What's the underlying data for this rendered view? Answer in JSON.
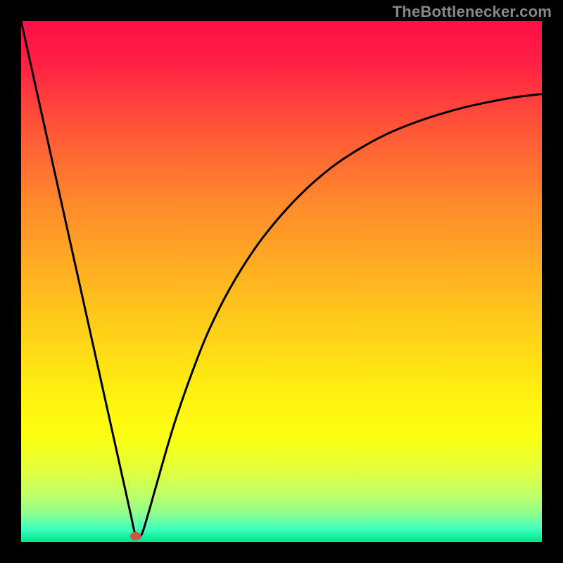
{
  "watermark": "TheBottlenecker.com",
  "chart_data": {
    "type": "line",
    "title": "",
    "xlabel": "",
    "ylabel": "",
    "xlim": [
      0,
      100
    ],
    "ylim": [
      0,
      100
    ],
    "grid": false,
    "background_gradient": {
      "stops": [
        {
          "offset": 0.0,
          "color": "#ff0e46"
        },
        {
          "offset": 0.08,
          "color": "#ff2044"
        },
        {
          "offset": 0.2,
          "color": "#ff5338"
        },
        {
          "offset": 0.35,
          "color": "#ff8a2c"
        },
        {
          "offset": 0.55,
          "color": "#ffc41c"
        },
        {
          "offset": 0.72,
          "color": "#fff210"
        },
        {
          "offset": 0.8,
          "color": "#fbff12"
        },
        {
          "offset": 0.86,
          "color": "#e3ff3a"
        },
        {
          "offset": 0.91,
          "color": "#bfff68"
        },
        {
          "offset": 0.945,
          "color": "#8eff8e"
        },
        {
          "offset": 0.975,
          "color": "#3effbf"
        },
        {
          "offset": 1.0,
          "color": "#00e588"
        }
      ]
    },
    "bottleneck_marker": {
      "x": 22,
      "y": 1.1,
      "color": "#c55a4a"
    },
    "series": [
      {
        "name": "bottleneck-curve",
        "color": "#000000",
        "x": [
          0,
          2,
          4,
          6,
          8,
          10,
          12,
          14,
          16,
          18,
          20,
          21,
          22,
          23,
          24,
          26,
          28,
          30,
          33,
          36,
          40,
          45,
          50,
          55,
          60,
          65,
          70,
          75,
          80,
          85,
          90,
          95,
          100
        ],
        "values": [
          100,
          91,
          82,
          73,
          64,
          55,
          46,
          37,
          28,
          19,
          10,
          5.5,
          1.2,
          1.2,
          4,
          11,
          18,
          24.5,
          33,
          40.5,
          48.5,
          56.5,
          62.8,
          68,
          72.2,
          75.5,
          78.2,
          80.3,
          82,
          83.4,
          84.5,
          85.4,
          86
        ]
      }
    ]
  }
}
